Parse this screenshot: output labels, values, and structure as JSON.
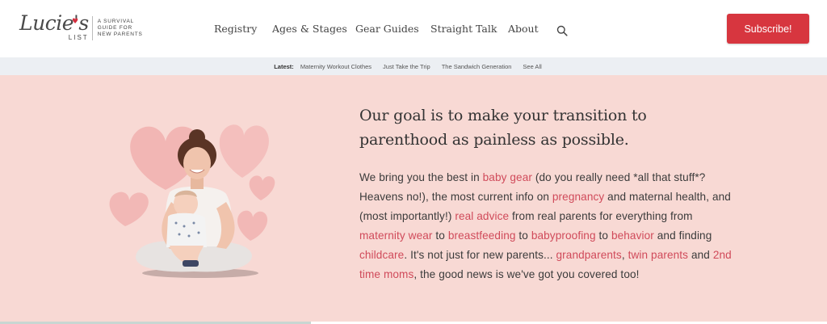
{
  "logo": {
    "word": "Lucie's",
    "sub": "LIST",
    "tagline": [
      "A SURVIVAL",
      "GUIDE FOR",
      "NEW PARENTS"
    ]
  },
  "nav": {
    "items": [
      "Registry",
      "Ages & Stages",
      "Gear Guides",
      "Straight Talk",
      "About"
    ]
  },
  "header": {
    "subscribe_label": "Subscribe!"
  },
  "latest": {
    "label": "Latest:",
    "links": [
      "Maternity Workout Clothes",
      "Just Take the Trip",
      "The Sandwich Generation",
      "See All"
    ]
  },
  "hero": {
    "title": "Our goal is to make your transition to parenthood as painless as possible.",
    "body": {
      "t1": "We bring you the best in ",
      "l1": "baby gear",
      "t2": " (do you really need *all that stuff*? Heavens no!), the most current info on ",
      "l2": "pregnancy",
      "t3": " and maternal health, and (most importantly!) ",
      "l3": "real advice",
      "t4": " from real parents for everything from ",
      "l4": "maternity wear",
      "t5": " to ",
      "l5": "breastfeeding",
      "t6": " to ",
      "l6": "babyproofing",
      "t7": " to ",
      "l7": "behavior",
      "t8": " and finding ",
      "l8": "childcare",
      "t9": ". It's not just for new parents... ",
      "l9": "grandparents",
      "t10": ", ",
      "l10": "twin parents",
      "t11": " and ",
      "l11": "2nd time moms",
      "t12": ", the good news is we've got you covered too!"
    }
  },
  "colors": {
    "brand_red": "#d7363f",
    "hero_bg": "#f8d9d4",
    "link": "#d04a5a",
    "latest_bg": "#eceff3"
  },
  "icons": {
    "search": "search-icon",
    "hearts": "heart-icon"
  }
}
